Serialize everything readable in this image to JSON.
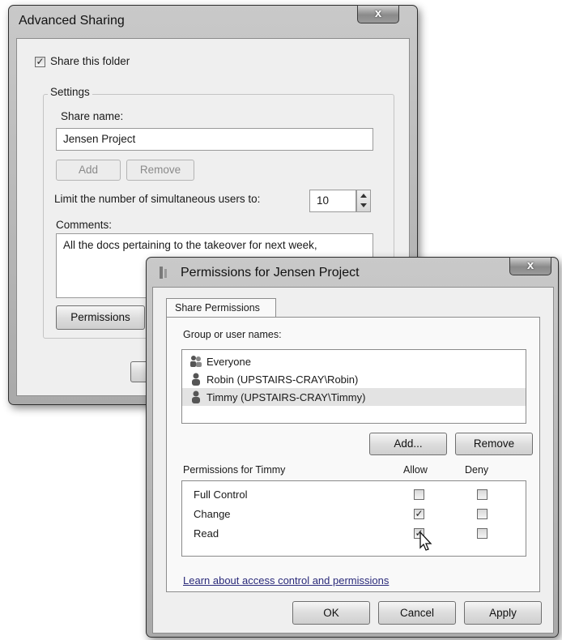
{
  "advanced_sharing": {
    "title": "Advanced Sharing",
    "share_folder_label": "Share this folder",
    "share_folder_checked": true,
    "settings_label": "Settings",
    "share_name_label": "Share name:",
    "share_name_value": "Jensen Project",
    "add_label": "Add",
    "remove_label": "Remove",
    "limit_label": "Limit the number of simultaneous users to:",
    "limit_value": "10",
    "comments_label": "Comments:",
    "comments_value": "All the docs pertaining to the takeover for next week,",
    "permissions_label": "Permissions"
  },
  "permissions": {
    "title": "Permissions for Jensen Project",
    "tab_label": "Share Permissions",
    "group_label": "Group or user names:",
    "users": [
      {
        "name": "Everyone",
        "icon": "group-icon",
        "selected": false
      },
      {
        "name": "Robin (UPSTAIRS-CRAY\\Robin)",
        "icon": "user-icon",
        "selected": false
      },
      {
        "name": "Timmy (UPSTAIRS-CRAY\\Timmy)",
        "icon": "user-icon",
        "selected": true
      }
    ],
    "add_label": "Add...",
    "remove_label": "Remove",
    "perm_for_label": "Permissions for Timmy",
    "allow_label": "Allow",
    "deny_label": "Deny",
    "rows": [
      {
        "name": "Full Control",
        "allow": false,
        "deny": false
      },
      {
        "name": "Change",
        "allow": true,
        "deny": false
      },
      {
        "name": "Read",
        "allow": true,
        "deny": false
      }
    ],
    "learn_link": "Learn about access control and permissions",
    "ok_label": "OK",
    "cancel_label": "Cancel",
    "apply_label": "Apply"
  },
  "close_glyph": "x",
  "check_glyph": "✓"
}
